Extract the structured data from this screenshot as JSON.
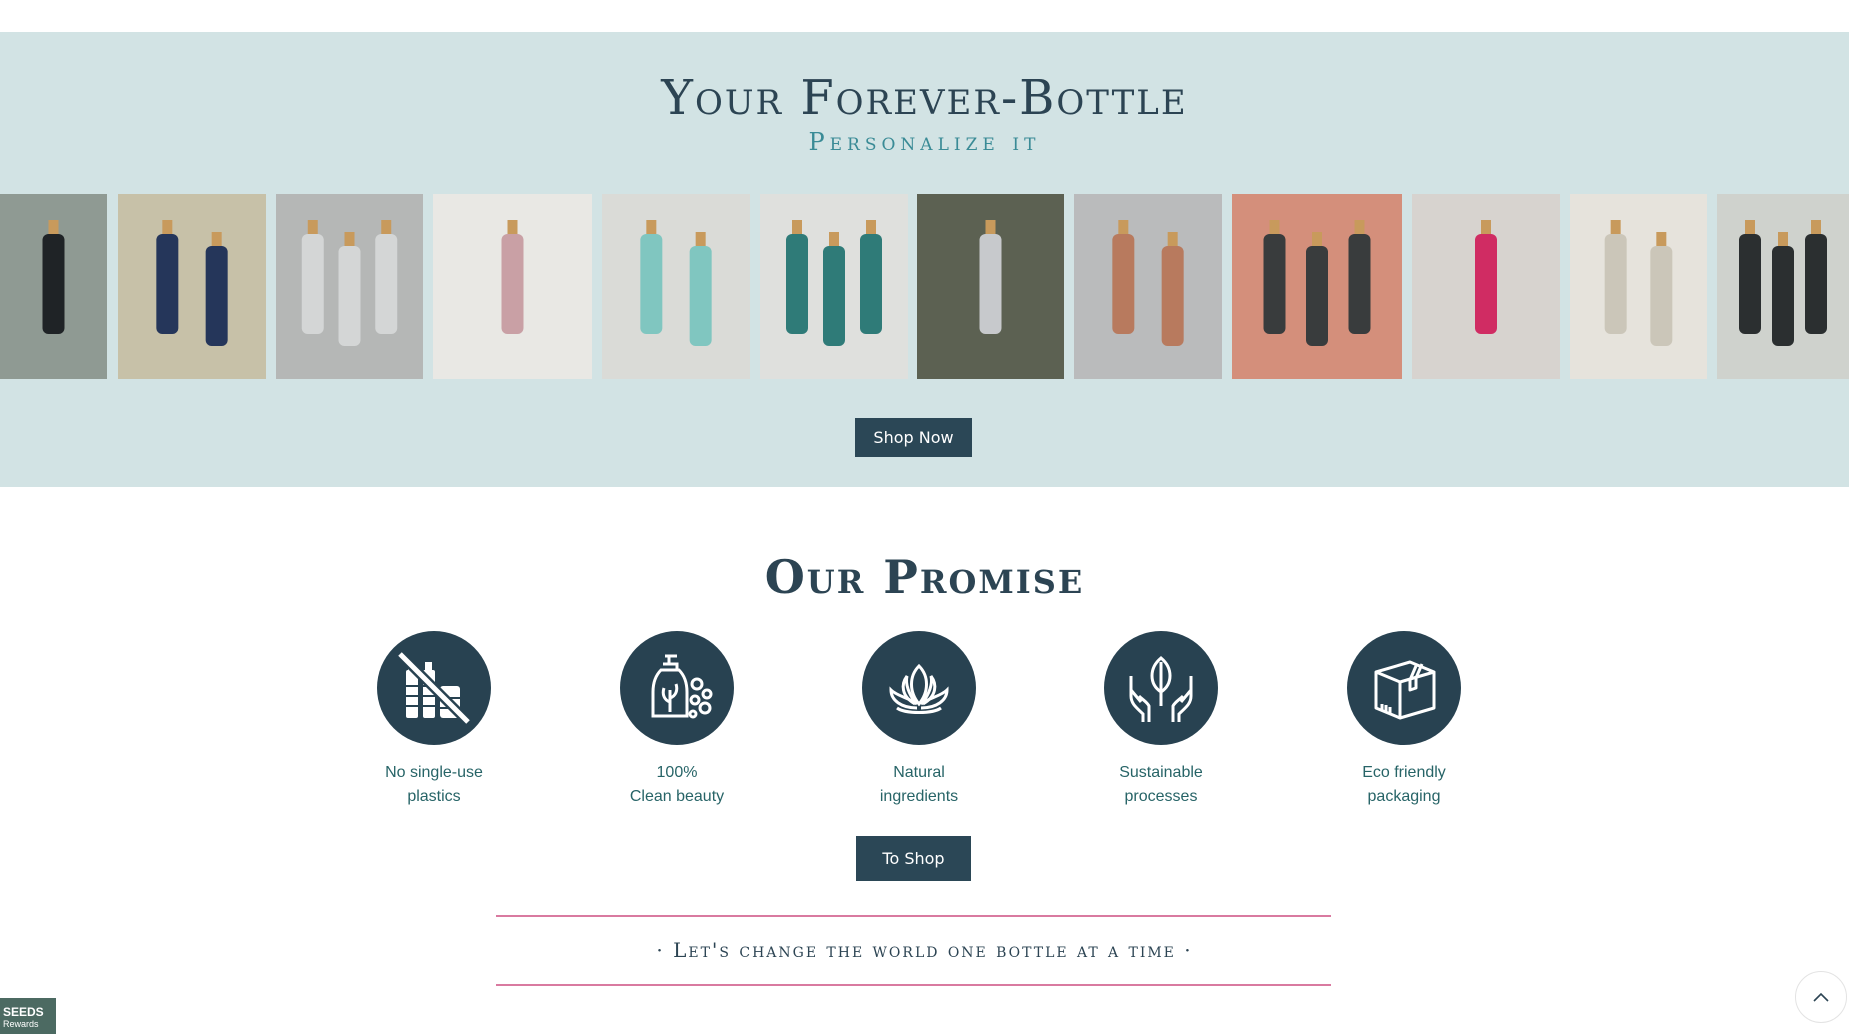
{
  "hero": {
    "title": "Your Forever-Bottle",
    "subtitle": "Personalize it",
    "shop_button": "Shop Now",
    "gallery": [
      {
        "name": "photo-black-bottles-plants",
        "bg": "#8f9a93",
        "bottle": "#1f2326"
      },
      {
        "name": "photo-navy-bottles-striped-towel",
        "bg": "#c7c1a8",
        "bottle": "#25365a"
      },
      {
        "name": "photo-silver-bottle-concrete",
        "bg": "#b5b7b6",
        "bottle": "#d4d6d6"
      },
      {
        "name": "photo-pink-bottle-sink",
        "bg": "#e9e8e4",
        "bottle": "#c9a0a5"
      },
      {
        "name": "photo-turquoise-bottles",
        "bg": "#dadbd7",
        "bottle": "#80c6c0"
      },
      {
        "name": "photo-teal-bottles-brush",
        "bg": "#dfe0dd",
        "bottle": "#2f7b78"
      },
      {
        "name": "photo-silver-bottles-wood",
        "bg": "#5c6152",
        "bottle": "#c7c9cc"
      },
      {
        "name": "photo-copper-bottles",
        "bg": "#babbbc",
        "bottle": "#b87a5e"
      },
      {
        "name": "photo-glitter-bottles-pink-wall",
        "bg": "#d48f7b",
        "bottle": "#393c3d"
      },
      {
        "name": "photo-pink-bottles",
        "bg": "#d7d3cf",
        "bottle": "#d02c63"
      },
      {
        "name": "photo-gold-bottles-tray",
        "bg": "#e6e3dc",
        "bottle": "#cbc6b9"
      },
      {
        "name": "photo-black-bottles-window",
        "bg": "#cfd2cd",
        "bottle": "#2b2f30"
      }
    ]
  },
  "promise": {
    "title": "Our Promise",
    "features": [
      {
        "label": "No single-use\nplastics",
        "icon": "no-plastic-bottles-icon"
      },
      {
        "label": "100%\nClean beauty",
        "icon": "soap-bottle-bubbles-icon"
      },
      {
        "label": "Natural\ningredients",
        "icon": "lotus-flower-icon"
      },
      {
        "label": "Sustainable\nprocesses",
        "icon": "hands-leaf-icon"
      },
      {
        "label": "Eco friendly\npackaging",
        "icon": "box-package-icon"
      }
    ],
    "shop_button": "To Shop",
    "tagline": "· Let's change the world one bottle at a time ·"
  },
  "seeds_badge": {
    "line1": "SEEDS",
    "line2": "Rewards"
  },
  "colors": {
    "hero_bg": "#d2e3e4",
    "dark": "#2b4756",
    "teal_text": "#276467",
    "pink_rule": "#d97aa0"
  }
}
